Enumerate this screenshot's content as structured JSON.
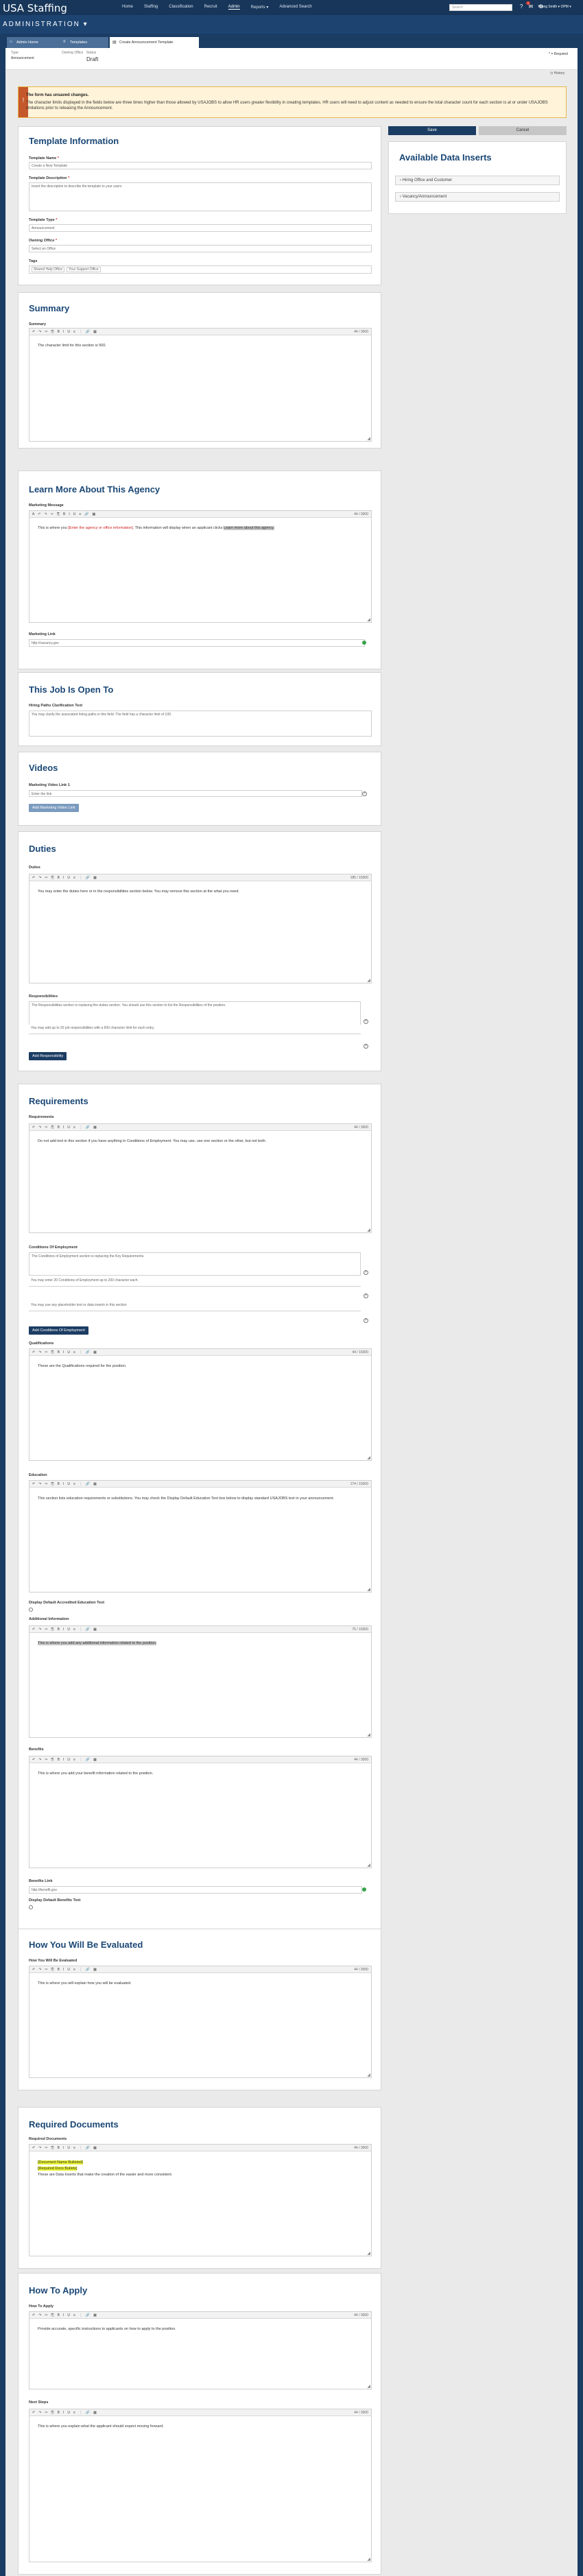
{
  "header": {
    "logo": "USA Staffing",
    "nav": [
      "Home",
      "Staffing",
      "Classification",
      "Recruit",
      "Admin",
      "Reports ▾",
      "Advanced Search"
    ],
    "search_placeholder": "Search",
    "notif_count": "2",
    "user": "Young Smith ▾ OPM ▾",
    "app_name": "ADMINISTRATION ▾"
  },
  "tabs": [
    {
      "label": "Admin Home"
    },
    {
      "label": "Templates"
    },
    {
      "label": "Create Announcement Template"
    }
  ],
  "status": {
    "type_label": "Type",
    "type_value": "Announcement",
    "office_label": "Owning Office",
    "office_value": "",
    "status_label": "Status",
    "status_value": "Draft",
    "required": "* = Required",
    "history": "History"
  },
  "warning": {
    "title": "The form has unsaved changes.",
    "body": "The character limits displayed in the fields below are three times higher than those allowed by USAJOBS to allow HR users greater flexibility in creating templates. HR users will need to adjust content as needed to ensure the total character count for each section is at or under USAJOBS limitations prior to releasing the Announcement."
  },
  "actions": {
    "save": "Save",
    "cancel": "Cancel"
  },
  "data_inserts": {
    "title": "Available Data Inserts",
    "items": [
      "Hiring Office and Customer",
      "Vacancy/Announcement"
    ]
  },
  "template_info": {
    "title": "Template Information",
    "name_label": "Template Name",
    "name_value": "Create a New Template",
    "desc_label": "Template Description",
    "desc_value": "Insert the description to describe the template to your users",
    "type_label": "Template Type",
    "type_value": "Announcement",
    "office_label": "Owning Office",
    "office_value": "Select an Office",
    "tags_label": "Tags",
    "tags": [
      "Shared Help Office",
      "Your Support Office"
    ]
  },
  "summary": {
    "title": "Summary",
    "label": "Summary",
    "count": "44 / 3000",
    "text": "The character limit for this section is 500."
  },
  "learn_more": {
    "title": "Learn More About This Agency",
    "msg_label": "Marketing Message",
    "count": "44 / 3000",
    "text_a": "This is where you ",
    "text_red": "[Enter the agency or office information]",
    "text_b": ". This information will display when an applicant clicks ",
    "text_hl": "Learn more about this agency.",
    "link_label": "Marketing Link",
    "link_value": "http://vacancy.gov"
  },
  "open_to": {
    "title": "This Job Is Open To",
    "label": "Hiring Paths Clarification Text",
    "text": "You may clarify the associated hiring paths in this field. The field has a character limit of 100."
  },
  "videos": {
    "title": "Videos",
    "label": "Marketing Video Link 1",
    "placeholder": "Enter the link",
    "add": "Add Marketing Video Link"
  },
  "duties": {
    "title": "Duties",
    "label": "Duties",
    "count": "185 / 15000",
    "text": "You may enter the duties here or in the responsibilities section below. You may remove this section at the what you need.",
    "resp_label": "Responsibilities",
    "resp_text": "The Responsibilities section is replacing the duties section. You should use this section to list the Responsibilities of the position.",
    "resp_hint": "You may add up to 20 job responsibilities with a 600 character limit for each entry.",
    "add": "Add Responsibility"
  },
  "requirements": {
    "title": "Requirements",
    "label": "Requirements",
    "count": "44 / 3000",
    "text": "Do not add text in this section if you have anything in Conditions of Employment. You may use, use one section or the other, but not both.",
    "coe_label": "Conditions Of Employment",
    "coe_text": "The Conditions of Employment section is replacing the Key Requirements.",
    "coe_hint": "You may enter 20 Conditions of Employment up to 200 character each.",
    "coe_hint2": "You may use any placeholder text or data inserts in this section",
    "coe_add": "Add Conditions Of Employment",
    "qual_label": "Qualifications",
    "qual_count": "44 / 15000",
    "qual_text": "These are the Qualifications required for the position.",
    "edu_label": "Education",
    "edu_count": "174 / 15000",
    "edu_text": "This section lists education requirements or substitutions. You may check the Display Default Education Text box below to display standard USAJOBS text in your announcement.",
    "edu_default": "Display Default Accredited Education Text",
    "addl_label": "Additional Information",
    "addl_count": "75 / 15000",
    "addl_text": "This is where you add any additional information related to the position.",
    "ben_label": "Benefits",
    "ben_count": "44 / 3000",
    "ben_text": "This is where you add your benefit information related to the position.",
    "ben_link_label": "Benefits Link",
    "ben_link_value": "http://benefit.gov",
    "ben_default": "Display Default Benefits Text"
  },
  "evaluated": {
    "title": "How You Will Be Evaluated",
    "label": "How You Will Be Evaluated",
    "count": "44 / 3000",
    "text": "This is where you will explain how you will be evaluated."
  },
  "required_docs": {
    "title": "Required Documents",
    "label": "Required Documents",
    "count": "44 / 3000",
    "hl1": "[Document Name Bulleted]",
    "hl2": "[Required Docs Bullets]",
    "text": "These are Data Inserts that make the creation of the easier and more consistent."
  },
  "how_to_apply": {
    "title": "How To Apply",
    "label": "How To Apply",
    "count": "44 / 3000",
    "text": "Provide accurate, specific instructions to applicants on how to apply to the position.",
    "next_label": "Next Steps",
    "next_count": "44 / 3000",
    "next_text": "This is where you explain what the applicant should expect moving forward."
  }
}
